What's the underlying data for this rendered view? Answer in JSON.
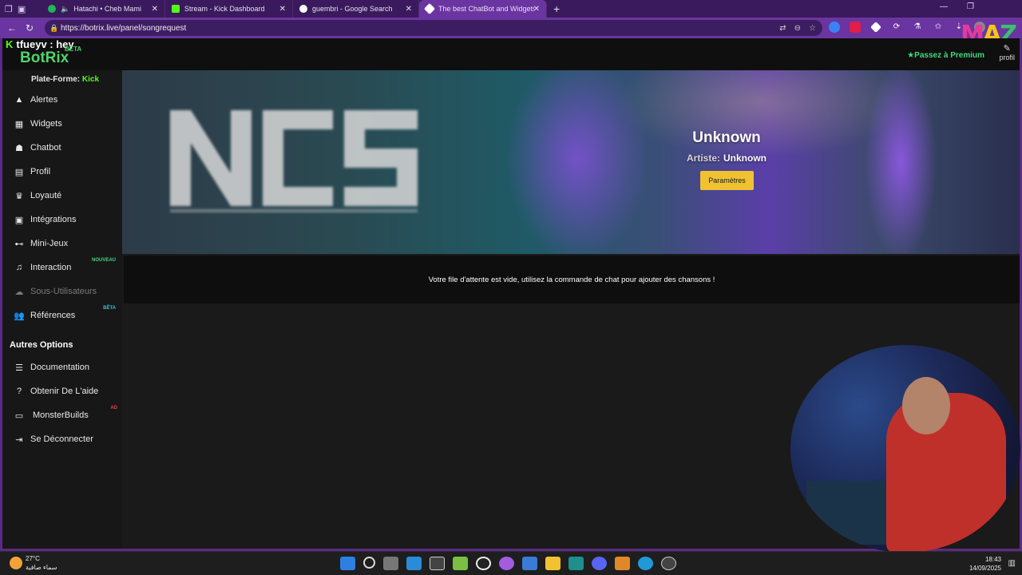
{
  "browser": {
    "tabs": [
      {
        "title": "Hatachi • Cheb Mami",
        "favicon_color": "#1db954",
        "audio": true
      },
      {
        "title": "Stream - Kick Dashboard",
        "favicon_color": "#53fc18"
      },
      {
        "title": "guembri - Google Search",
        "favicon_color": "#ffffff"
      },
      {
        "title": "The best ChatBot and Widgets fo",
        "favicon_color": "#ffffff",
        "active": true
      }
    ],
    "new_tab": "+",
    "url": "https://botrix.live/panel/songrequest"
  },
  "header": {
    "stream_title": "tfueyv : hey",
    "brand": "BotRix",
    "beta": "BETA",
    "premium_label": "Passez à Premium",
    "profile_label": "profil"
  },
  "sidebar": {
    "platform_label": "Plate-Forme:",
    "platform_value": "Kick",
    "items": [
      {
        "label": "Alertes",
        "icon": "warning-icon"
      },
      {
        "label": "Widgets",
        "icon": "widgets-icon"
      },
      {
        "label": "Chatbot",
        "icon": "robot-icon"
      },
      {
        "label": "Profil",
        "icon": "id-card-icon"
      },
      {
        "label": "Loyauté",
        "icon": "trophy-icon"
      },
      {
        "label": "Intégrations",
        "icon": "integration-icon"
      },
      {
        "label": "Mini-Jeux",
        "icon": "gamepad-icon"
      },
      {
        "label": "Interaction",
        "icon": "music-icon",
        "badge": "NOUVEAU"
      },
      {
        "label": "Sous-Utilisateurs",
        "icon": "users-icon",
        "disabled": true
      },
      {
        "label": "Références",
        "icon": "user-group-icon",
        "badge": "BÊTA"
      }
    ],
    "other_title": "Autres Options",
    "other_items": [
      {
        "label": "Documentation",
        "icon": "document-icon"
      },
      {
        "label": "Obtenir De L'aide",
        "icon": "help-icon"
      },
      {
        "label": "MonsterBuilds",
        "icon": "laptop-icon",
        "badge": "AD"
      },
      {
        "label": "Se Déconnecter",
        "icon": "logout-icon"
      }
    ]
  },
  "player": {
    "title": "Unknown",
    "artist_label": "Artiste:",
    "artist": "Unknown",
    "settings_button": "Paramètres",
    "cover_text": "NCS"
  },
  "queue": {
    "empty_message": "Votre file d'attente est vide, utilisez la commande de chat pour ajouter des chansons !"
  },
  "taskbar": {
    "temperature": "27°C",
    "weather_text": "سماء صافية",
    "time": "18:43",
    "date": "14/09/2025"
  },
  "colors": {
    "accent_green": "#53fc18",
    "brand_green": "#4fd36a",
    "button_yellow": "#f0c232",
    "browser_purple": "#6a35a0"
  }
}
